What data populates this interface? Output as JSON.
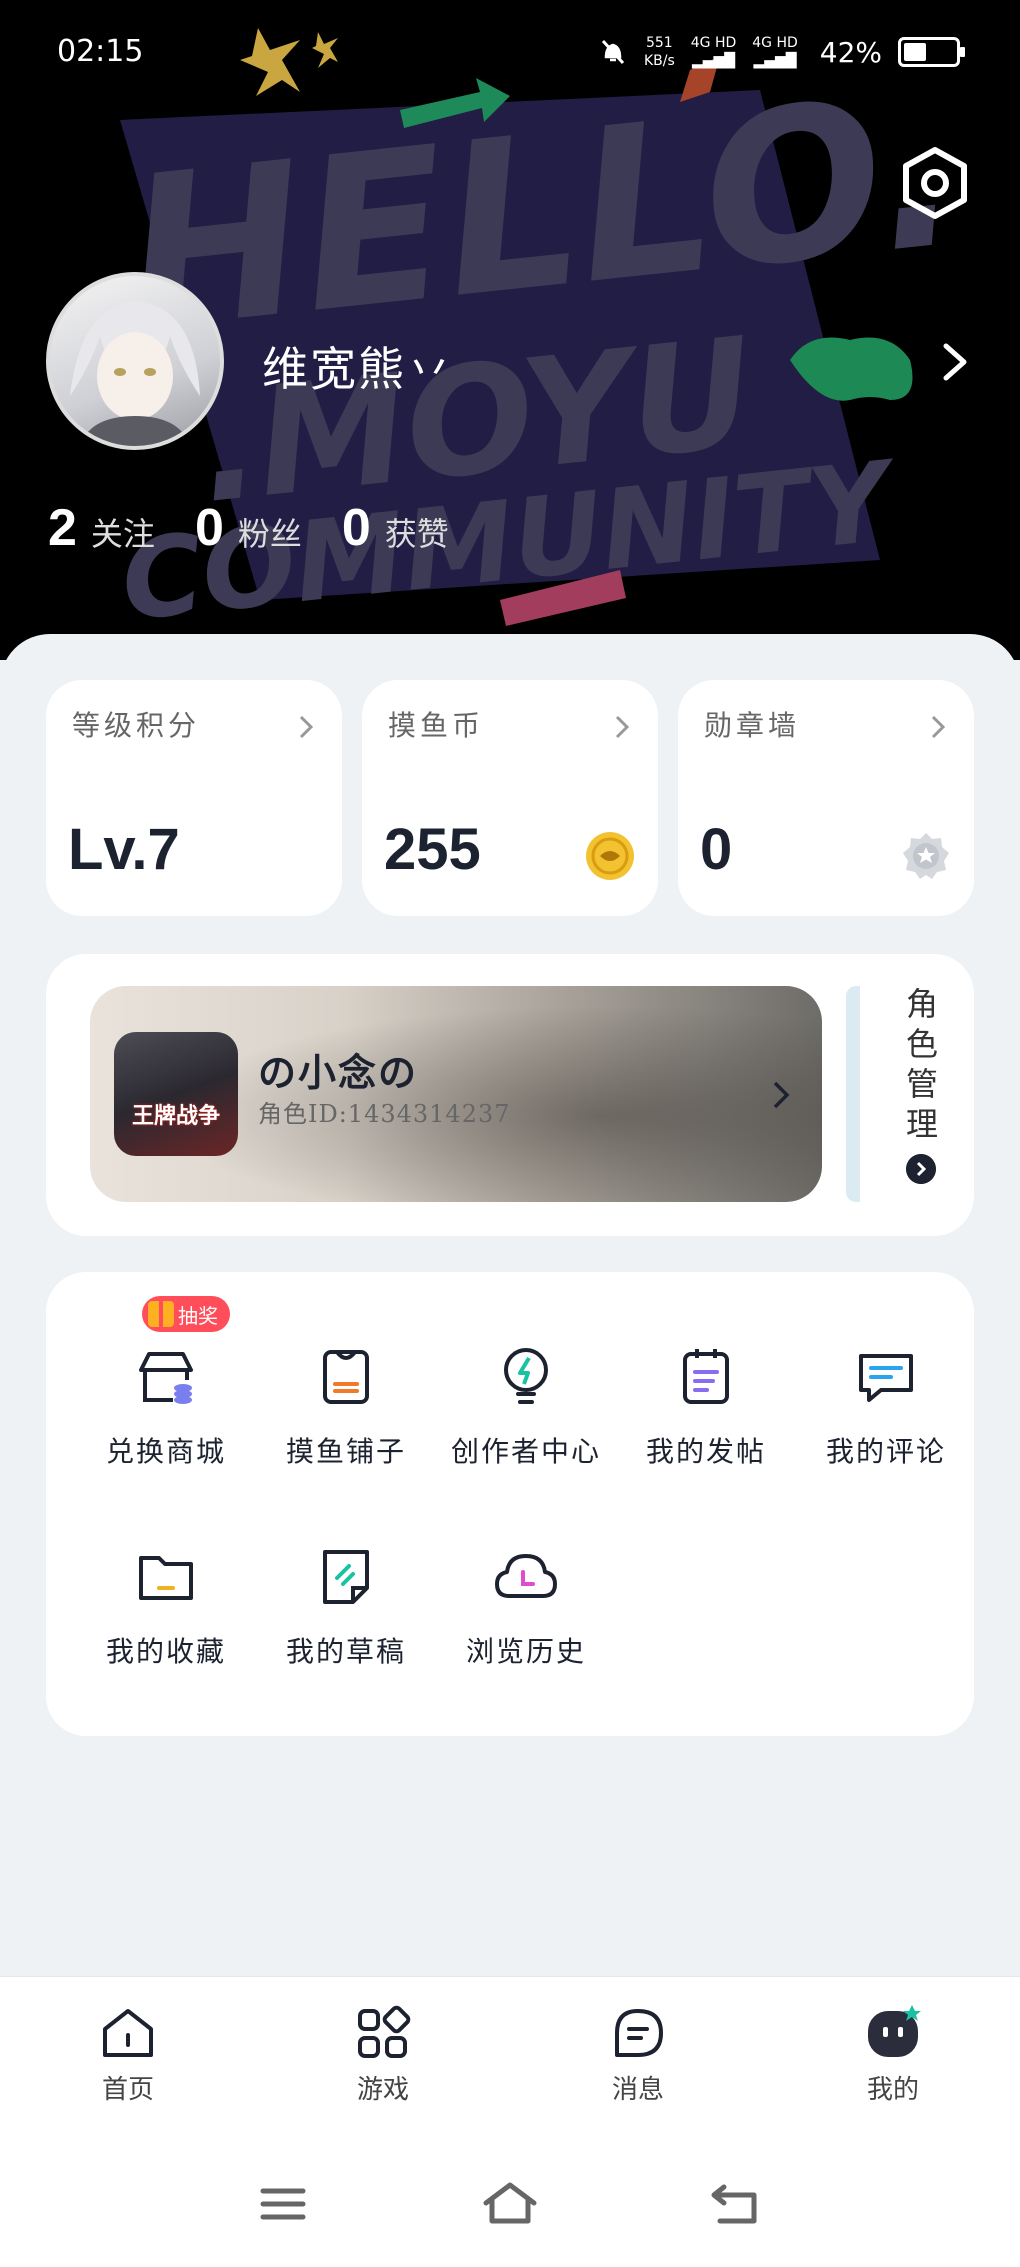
{
  "status": {
    "time": "02:15",
    "speed_value": "551",
    "speed_unit": "KB/s",
    "net1": "4G HD",
    "net2": "4G HD",
    "battery_pct": "42%",
    "battery_level": 0.42
  },
  "bg": {
    "line1": "HELLO.",
    "line2": ".MOYU",
    "line3": "COMMUNITY"
  },
  "profile": {
    "username": "维宽熊丷",
    "stats": [
      {
        "num": "2",
        "label": "关注"
      },
      {
        "num": "0",
        "label": "粉丝"
      },
      {
        "num": "0",
        "label": "获赞"
      }
    ]
  },
  "cards": [
    {
      "title": "等级积分",
      "value": "Lv.7",
      "icon": "none"
    },
    {
      "title": "摸鱼币",
      "value": "255",
      "icon": "fish-coin-icon"
    },
    {
      "title": "勋章墙",
      "value": "0",
      "icon": "medal-icon"
    }
  ],
  "role": {
    "game_label": "王牌战争",
    "name": "の小念の",
    "id_text": "角色ID:1434314237",
    "manage_label": "角色管理"
  },
  "menu": {
    "badge": "抽奖",
    "items": [
      {
        "label": "兑换商城"
      },
      {
        "label": "摸鱼铺子"
      },
      {
        "label": "创作者中心"
      },
      {
        "label": "我的发帖"
      },
      {
        "label": "我的评论"
      },
      {
        "label": "我的收藏"
      },
      {
        "label": "我的草稿"
      },
      {
        "label": "浏览历史"
      }
    ]
  },
  "nav": {
    "items": [
      {
        "label": "首页"
      },
      {
        "label": "游戏"
      },
      {
        "label": "消息"
      },
      {
        "label": "我的"
      }
    ]
  },
  "colors": {
    "accent_green": "#19c2a0",
    "coin_gold": "#f2c230",
    "badge_red": "#ff4d5a",
    "dark": "#1d2230"
  }
}
